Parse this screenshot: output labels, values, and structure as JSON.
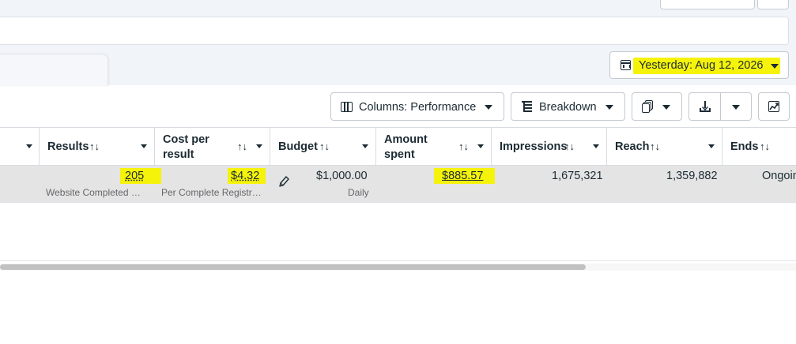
{
  "date_range": {
    "label": "Yesterday: Aug 12, 2026",
    "icon": "calendar-icon"
  },
  "toolbar": {
    "columns_label": "Columns: Performance",
    "breakdown_label": "Breakdown",
    "icons": [
      "columns-icon",
      "breakdown-icon",
      "reports-icon",
      "download-icon",
      "chart-icon"
    ]
  },
  "table": {
    "headers": {
      "results": "Results",
      "cost_line1": "Cost per",
      "cost_line2": "result",
      "budget": "Budget",
      "amount_line1": "Amount",
      "amount_line2": "spent",
      "impressions": "Impressions",
      "reach": "Reach",
      "ends": "Ends"
    },
    "sort_icon": "↑↓",
    "row": {
      "results": "205",
      "results_sub": "Website Completed …",
      "cost": "$4.32",
      "cost_sub": "Per Complete Registr…",
      "budget": "$1,000.00",
      "budget_sub": "Daily",
      "amount_spent": "$885.57",
      "impressions": "1,675,321",
      "reach": "1,359,882",
      "ends": "Ongoing"
    }
  },
  "colors": {
    "highlight": "#f6f30a",
    "text": "#1c2b33",
    "row_bg": "#e4e4e4"
  },
  "scrollbar": {
    "horizontal_position": 0
  }
}
